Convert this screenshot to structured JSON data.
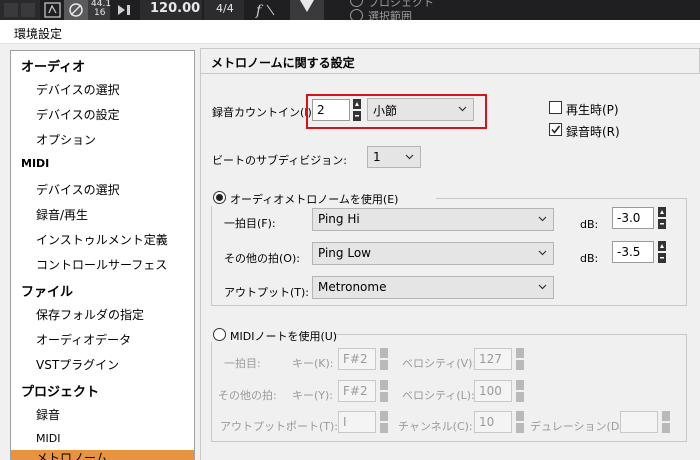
{
  "appbar": {
    "rate": "44.1",
    "bits": "16",
    "tempo": "120.00",
    "signature": "4/4",
    "right_text_1": "プロジェクト",
    "right_text_2": "選択範囲"
  },
  "window": {
    "title": "環境設定"
  },
  "sidebar": {
    "sections": [
      {
        "label": "オーディオ",
        "items": [
          "デバイスの選択",
          "デバイスの設定",
          "オプション"
        ]
      },
      {
        "label": "MIDI",
        "items": [
          "デバイスの選択",
          "録音/再生",
          "インストゥルメント定義",
          "コントロールサーフェス"
        ]
      },
      {
        "label": "ファイル",
        "items": [
          "保存フォルダの指定",
          "オーディオデータ",
          "VSTプラグイン"
        ]
      },
      {
        "label": "プロジェクト",
        "items": [
          "録音",
          "MIDI",
          "メトロノーム"
        ]
      }
    ],
    "selected": "メトロノーム"
  },
  "panel": {
    "title": "メトロノームに関する設定",
    "count_in": {
      "label": "録音カウントイン(I)",
      "value": "2",
      "unit": "小節"
    },
    "on_play": {
      "label": "再生時(P)",
      "checked": false
    },
    "on_record": {
      "label": "録音時(R)",
      "checked": true
    },
    "subdivision": {
      "label": "ビートのサブディビジョン:",
      "value": "1"
    },
    "audio_metronome": {
      "label": "オーディオメトロノームを使用(E)",
      "selected": true,
      "first_beat": {
        "label": "一拍目(F):",
        "value": "Ping Hi",
        "db_label": "dB:",
        "db": "-3.0"
      },
      "other_beats": {
        "label": "その他の拍(O):",
        "value": "Ping Low",
        "db_label": "dB:",
        "db": "-3.5"
      },
      "output": {
        "label": "アウトプット(T):",
        "value": "Metronome"
      }
    },
    "midi_note": {
      "label": "MIDIノートを使用(U)",
      "selected": false,
      "first_beat": {
        "label": "一拍目:",
        "key_label": "キー(K):",
        "key": "F#2",
        "vel_label": "ベロシティ(V):",
        "vel": "127"
      },
      "other_beats": {
        "label": "その他の拍:",
        "key_label": "キー(Y):",
        "key": "F#2",
        "vel_label": "ベロシティ(L):",
        "vel": "100"
      },
      "output": {
        "label": "アウトプット:",
        "port_label": "ポート(T):",
        "port": "I",
        "ch_label": "チャンネル(C):",
        "ch": "10",
        "dur_label": "デュレーション(D):",
        "dur": ""
      }
    }
  },
  "colors": {
    "accent": "#e8943f",
    "highlight": "#d4141a"
  }
}
